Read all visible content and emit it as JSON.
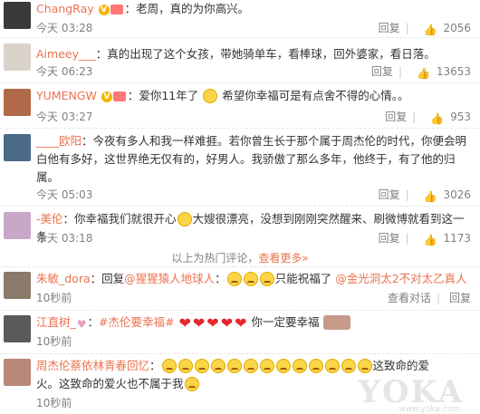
{
  "comments": [
    {
      "user": "ChangRay",
      "text": "：老周，真的为你高兴。",
      "time": "今天 03:28",
      "reply": "回复",
      "likes": "2056"
    },
    {
      "user": "Aimeey___",
      "text": "：真的出现了这个女孩，带她骑单车，看棒球，回外婆家，看日落。",
      "time": "今天 06:23",
      "reply": "回复",
      "likes": "13653"
    },
    {
      "user": "YUMENGW",
      "text_a": "：爱你11年了",
      "text_b": "希望你幸福可是有点舍不得的心情。。",
      "time": "今天 03:27",
      "reply": "回复",
      "likes": "953"
    },
    {
      "user": "____欧阳",
      "text": "：今夜有多人和我一样难捱。若你曾生长于那个属于周杰伦的时代，你便会明白他有多好，这世界绝无仅有的，好男人。我骄傲了那么多年，他终于，有了他的归属。",
      "time": "今天 05:03",
      "reply": "回复",
      "likes": "3026"
    },
    {
      "user": "-美伦",
      "text_a": "：你幸福我们就很开心",
      "text_b": "大嫂很漂亮，没想到刚刚突然醒来、刷微博就看到这一条",
      "time": "今天 03:18",
      "reply": "回复",
      "likes": "1173"
    }
  ],
  "hot_divider": {
    "text": "以上为热门评论，",
    "more": "查看更多»"
  },
  "recent": [
    {
      "user": "朱敏_dora",
      "prefix": "：回复",
      "mention": "@猩猩猿人地球人",
      "text": "只能祝福了",
      "mention2": "@金光洞太2不对太乙真人",
      "time": "10秒前",
      "view": "查看对话",
      "reply": "回复"
    },
    {
      "user": "江直树_",
      "tag": "#杰伦要幸福#",
      "text": "你一定要幸福",
      "time": "10秒前"
    },
    {
      "user": "周杰伦蔡依林青春回忆",
      "text_a": "这致命的爱",
      "text_b": "火。这致命的爱火也不属于我",
      "time": "10秒前"
    }
  ],
  "watermark": "YOKA",
  "watermark_sub": "www.yoka.com"
}
